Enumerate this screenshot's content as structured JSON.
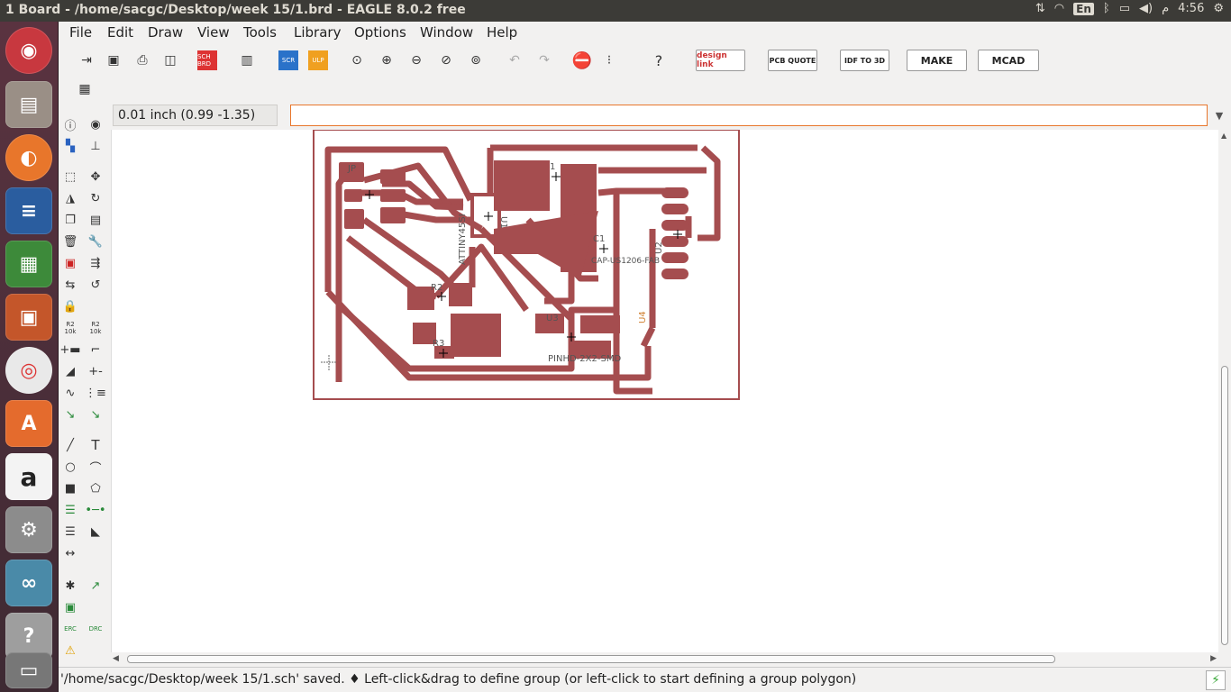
{
  "window": {
    "title": "1 Board - /home/sacgc/Desktop/week 15/1.brd - EAGLE 8.0.2 free"
  },
  "tray": {
    "lang": "En",
    "time": "4:56",
    "ampm": "م"
  },
  "menu": [
    "File",
    "Edit",
    "Draw",
    "View",
    "Tools",
    "Library",
    "Options",
    "Window",
    "Help"
  ],
  "toolbar": {
    "sch_brd": "SCH BRD",
    "scr": "SCR",
    "ulp": "ULP",
    "designlink": "design link",
    "pcbquote": "PCB QUOTE",
    "idf": "IDF TO 3D",
    "make": "MAKE",
    "mcad": "MCAD"
  },
  "coordinate": "0.01 inch (0.99 -1.35)",
  "command_value": "",
  "board": {
    "labels": {
      "jp": "JP",
      "attiny": "ATTINY45SI",
      "u1": "U1",
      "c1": "C1",
      "c1_value": "CAP-US1206-FAB",
      "r1": "1",
      "r2": "R2",
      "r3": "R3",
      "u3": "U3",
      "u4": "U4",
      "pin": "PINHD-2X2-SMD",
      "hdr": "U2"
    }
  },
  "leftbar": {
    "erc": "ERC",
    "drc": "DRC",
    "r2a": "R2",
    "r2b": "R2",
    "v10k": "10k"
  },
  "status": "'/home/sacgc/Desktop/week 15/1.sch' saved.  ♦ Left-click&drag to define group (or left-click to start defining a group polygon)"
}
